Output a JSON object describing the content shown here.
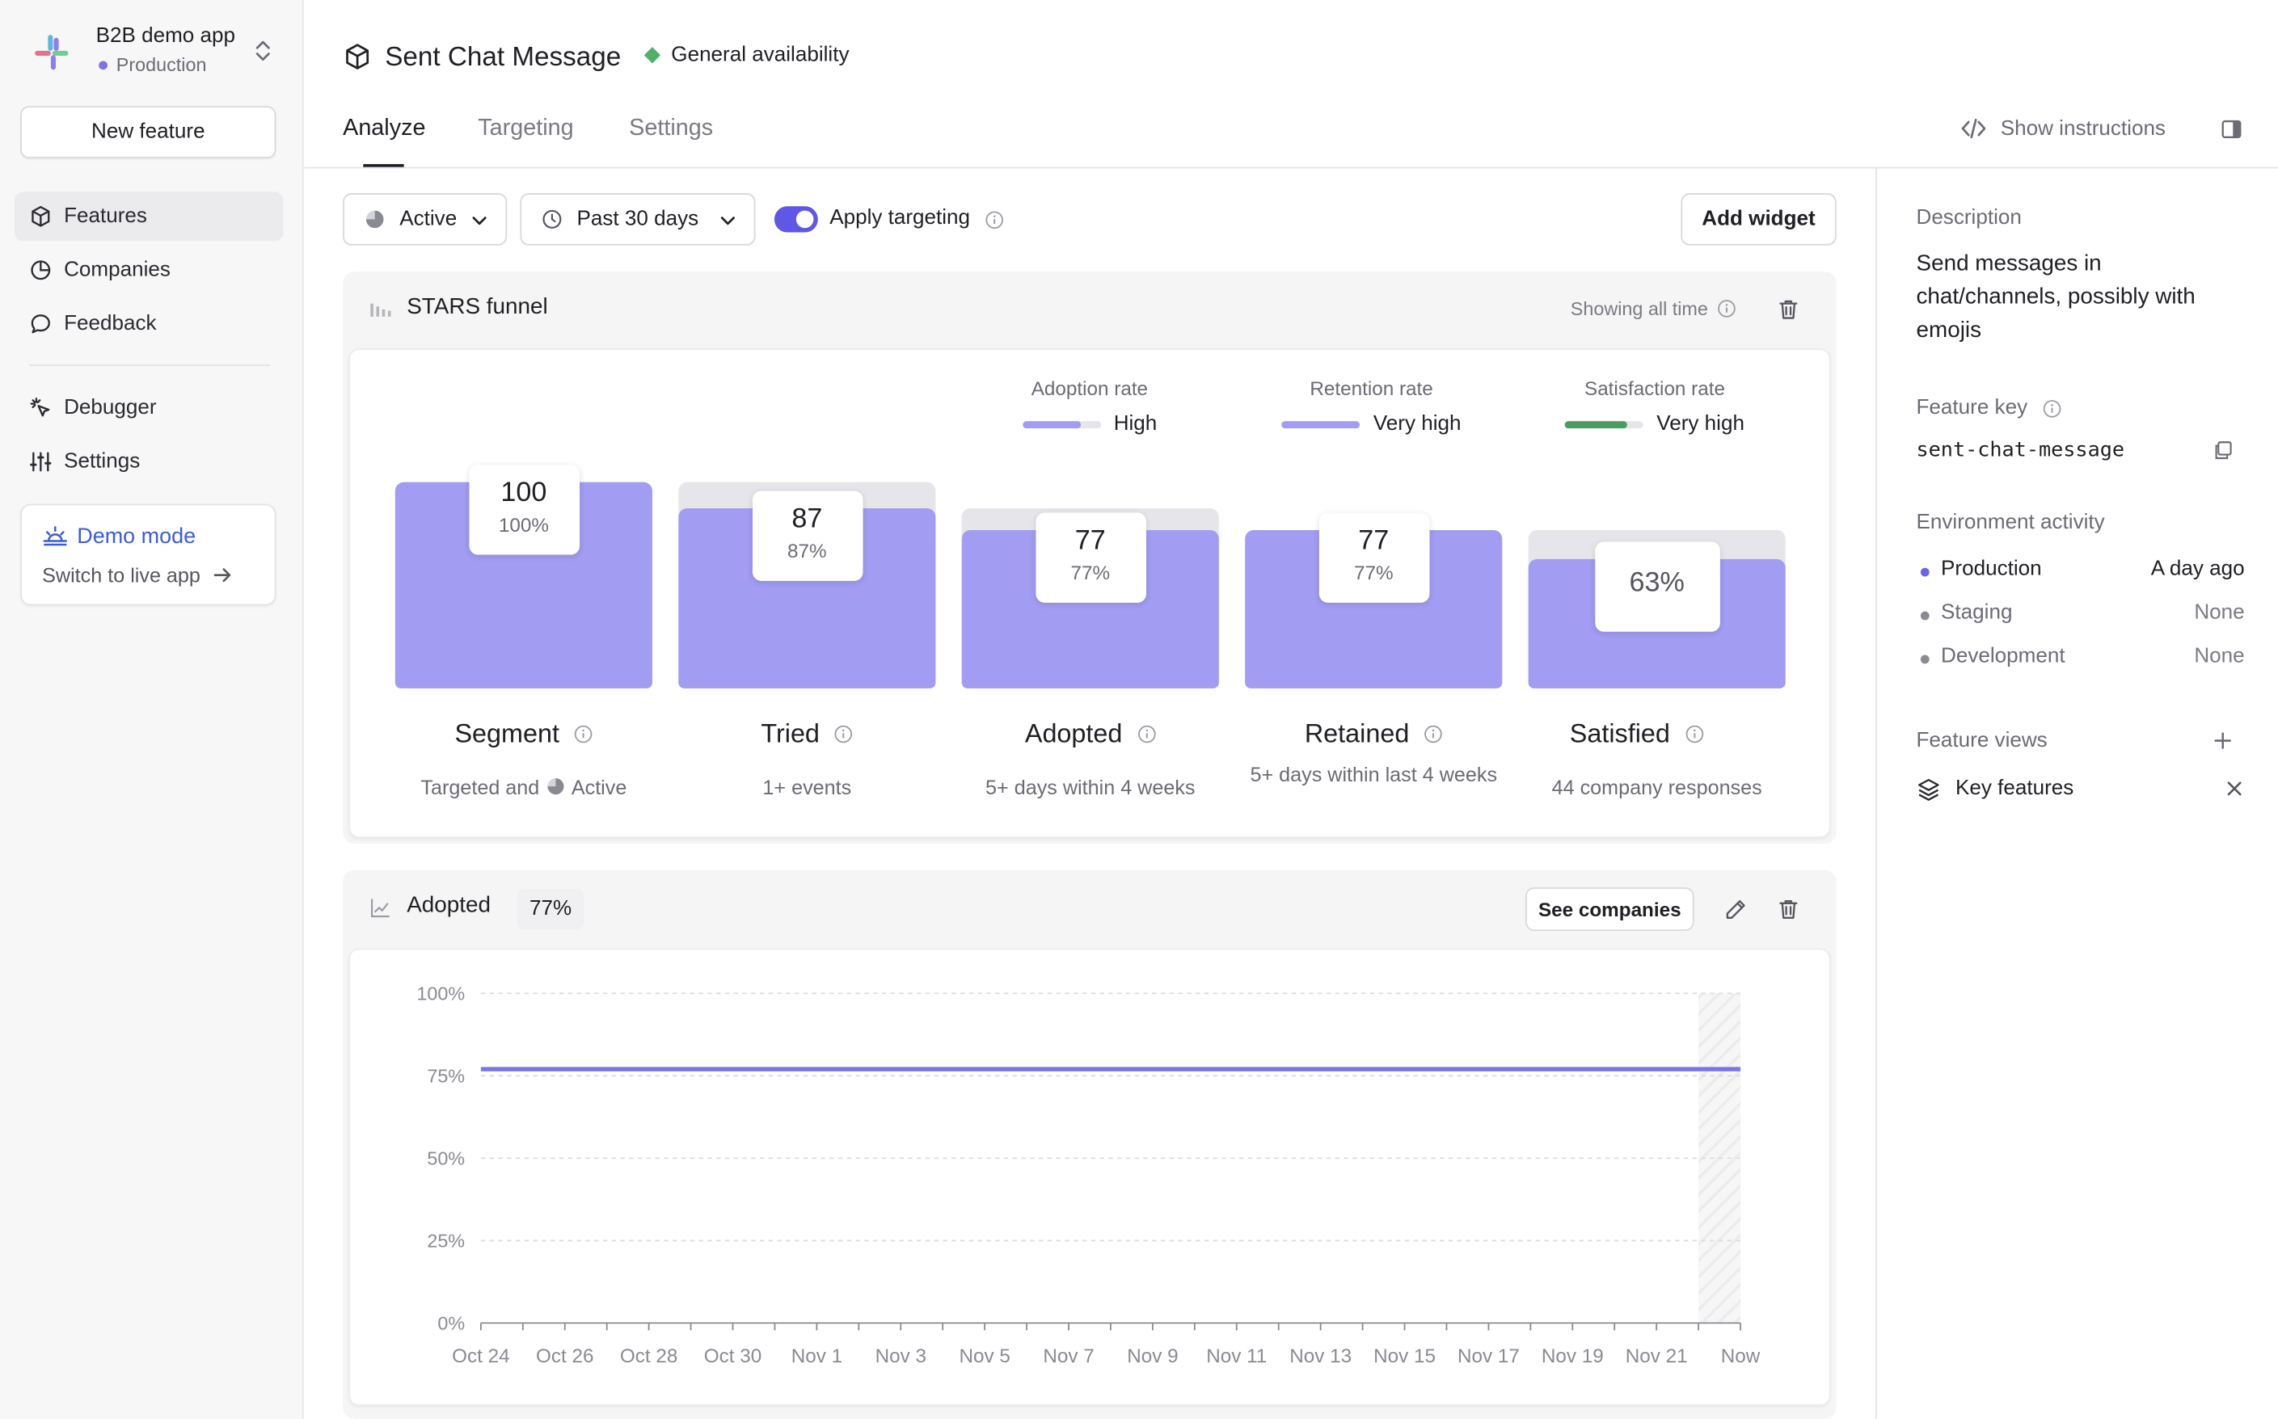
{
  "app": {
    "name": "B2B demo app",
    "environment": "Production"
  },
  "sidebar": {
    "new_feature_label": "New feature",
    "items": [
      {
        "label": "Features",
        "icon": "cube-icon",
        "active": true
      },
      {
        "label": "Companies",
        "icon": "pie-icon"
      },
      {
        "label": "Feedback",
        "icon": "chat-bubble-icon"
      },
      {
        "label": "Debugger",
        "icon": "cursor-click-icon"
      },
      {
        "label": "Settings",
        "icon": "sliders-icon"
      }
    ],
    "demo": {
      "title": "Demo mode",
      "subtitle": "Switch to live app"
    }
  },
  "header": {
    "title": "Sent Chat Message",
    "badge": "General availability",
    "badge_color": "#4fb06b",
    "tabs": [
      {
        "label": "Analyze",
        "active": true
      },
      {
        "label": "Targeting"
      },
      {
        "label": "Settings"
      }
    ],
    "show_instructions": "Show instructions"
  },
  "toolbar": {
    "status_filter": "Active",
    "period": "Past 30 days",
    "apply_targeting": "Apply targeting",
    "apply_targeting_on": true,
    "add_widget": "Add widget"
  },
  "funnel": {
    "title": "STARS funnel",
    "showing": "Showing all time",
    "rates": [
      {
        "label": "Adoption rate",
        "value": "High",
        "level": 0.75,
        "color": "#a29cf2"
      },
      {
        "label": "Retention rate",
        "value": "Very high",
        "level": 1.0,
        "color": "#a29cf2"
      },
      {
        "label": "Satisfaction rate",
        "value": "Very high",
        "level": 0.8,
        "color": "#4a9d62"
      }
    ],
    "stages": [
      {
        "name": "Segment",
        "count": "100",
        "pct": "100%",
        "fill": 1.0,
        "desc_prefix": "Targeted and",
        "desc_suffix": "Active"
      },
      {
        "name": "Tried",
        "count": "87",
        "pct": "87%",
        "fill": 0.87,
        "desc": "1+ events"
      },
      {
        "name": "Adopted",
        "count": "77",
        "pct": "77%",
        "fill": 0.77,
        "desc": "5+ days within 4 weeks"
      },
      {
        "name": "Retained",
        "count": "77",
        "pct": "77%",
        "fill": 0.77,
        "desc": "5+ days within last 4 weeks"
      },
      {
        "name": "Satisfied",
        "count": "",
        "pct": "63%",
        "fill": 0.63,
        "desc": "44 company responses"
      }
    ]
  },
  "adopted_widget": {
    "title": "Adopted",
    "value": "77%",
    "see_companies": "See companies"
  },
  "chart_data": {
    "type": "line",
    "title": "",
    "xlabel": "",
    "ylabel": "",
    "ylim": [
      0,
      100
    ],
    "y_ticks": [
      "0%",
      "25%",
      "50%",
      "75%",
      "100%"
    ],
    "x_tick_labels": [
      "Oct 24",
      "Oct 26",
      "Oct 28",
      "Oct 30",
      "Nov 1",
      "Nov 3",
      "Nov 5",
      "Nov 7",
      "Nov 9",
      "Nov 11",
      "Nov 13",
      "Nov 15",
      "Nov 17",
      "Nov 19",
      "Nov 21",
      "Now"
    ],
    "x": [
      "Oct 24",
      "Oct 25",
      "Oct 26",
      "Oct 27",
      "Oct 28",
      "Oct 29",
      "Oct 30",
      "Oct 31",
      "Nov 1",
      "Nov 2",
      "Nov 3",
      "Nov 4",
      "Nov 5",
      "Nov 6",
      "Nov 7",
      "Nov 8",
      "Nov 9",
      "Nov 10",
      "Nov 11",
      "Nov 12",
      "Nov 13",
      "Nov 14",
      "Nov 15",
      "Nov 16",
      "Nov 17",
      "Nov 18",
      "Nov 19",
      "Nov 20",
      "Nov 21",
      "Nov 22",
      "Now"
    ],
    "series": [
      {
        "values": [
          77,
          77,
          77,
          77,
          77,
          77,
          77,
          77,
          77,
          77,
          77,
          77,
          77,
          77,
          77,
          77,
          77,
          77,
          77,
          77,
          77,
          77,
          77,
          77,
          77,
          77,
          77,
          77,
          77,
          77,
          77
        ],
        "color": "#7b74e8"
      }
    ],
    "grid": true,
    "shaded_last_segment": true
  },
  "right_panel": {
    "description_label": "Description",
    "description": "Send messages in chat/channels, possibly with emojis",
    "feature_key_label": "Feature key",
    "feature_key": "sent-chat-message",
    "environment_activity_label": "Environment activity",
    "environments": [
      {
        "name": "Production",
        "value": "A day ago",
        "color": "#6b63e6",
        "active": true
      },
      {
        "name": "Staging",
        "value": "None",
        "color": "#8a8a92"
      },
      {
        "name": "Development",
        "value": "None",
        "color": "#8a8a92"
      }
    ],
    "feature_views_label": "Feature views",
    "feature_views": [
      {
        "label": "Key features"
      }
    ]
  }
}
